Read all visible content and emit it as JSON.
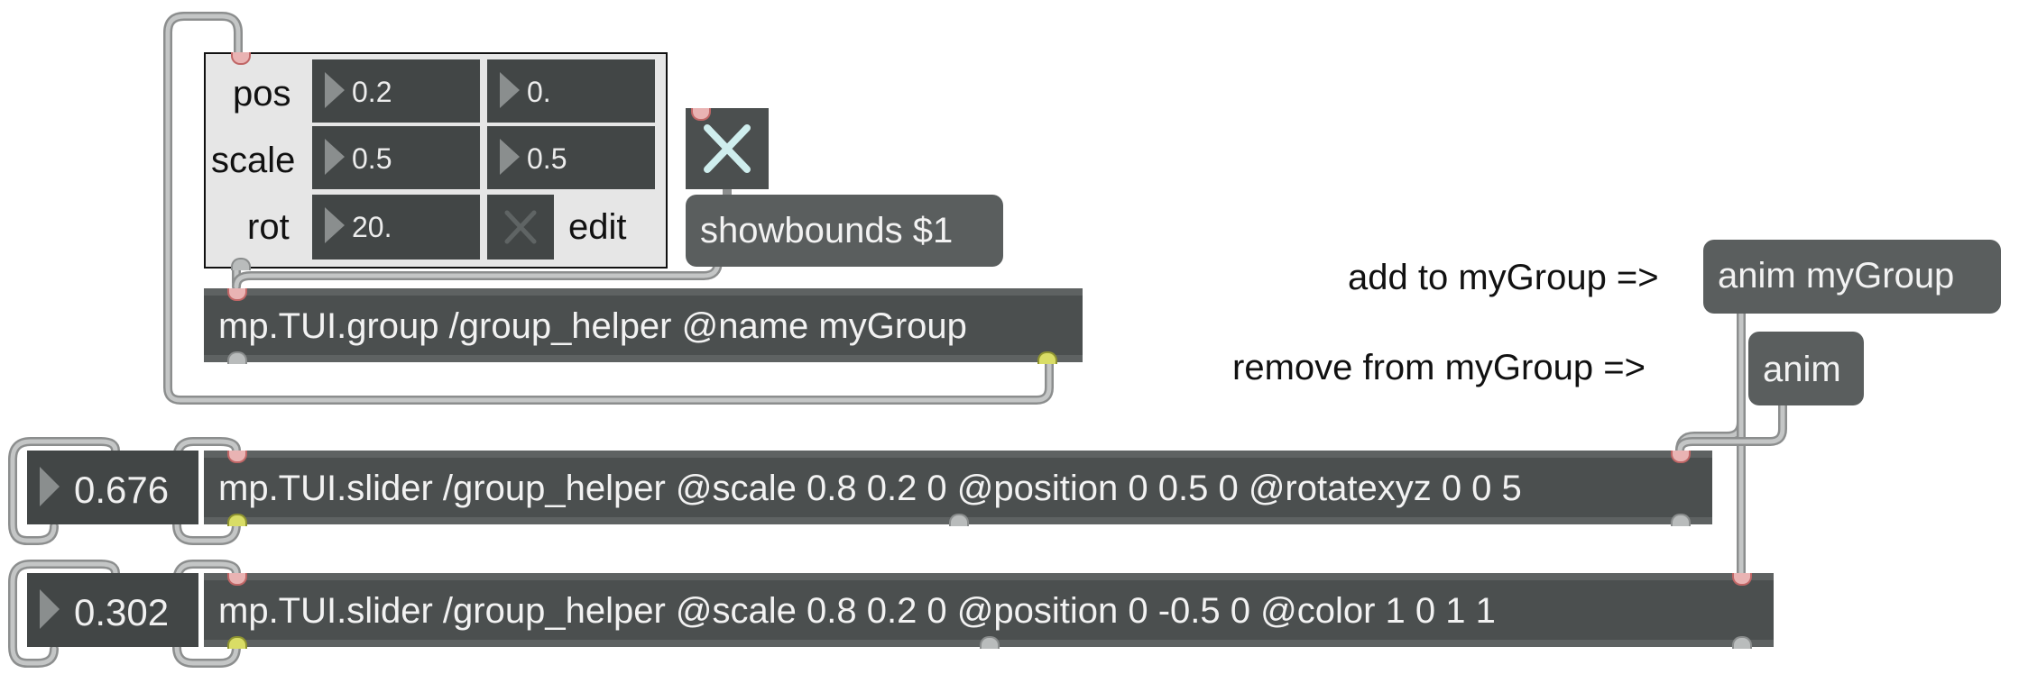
{
  "panel": {
    "pos_label": "pos",
    "scale_label": "scale",
    "rot_label": "rot",
    "edit_label": "edit",
    "pos_x": "0.2",
    "pos_y": "0.",
    "scale_x": "0.5",
    "scale_y": "0.5",
    "rot": "20."
  },
  "showbounds_msg": "showbounds $1",
  "group_obj": "mp.TUI.group /group_helper @name myGroup",
  "comments": {
    "add": "add to myGroup =>",
    "remove": "remove from myGroup =>"
  },
  "messages": {
    "anim_group": "anim myGroup",
    "anim": "anim"
  },
  "slider1": {
    "value": "0.676",
    "text": "mp.TUI.slider /group_helper @scale 0.8 0.2 0 @position 0 0.5 0 @rotatexyz 0 0 5"
  },
  "slider2": {
    "value": "0.302",
    "text": "mp.TUI.slider /group_helper @scale 0.8 0.2 0 @position 0 -0.5 0 @color 1 0 1 1"
  },
  "colors": {
    "object_bg": "#4b4f4f",
    "message_bg": "#5a5e5e",
    "cord": "#a8aaaa",
    "inlet": "#e9b3b3",
    "outlet": "#d9dd66"
  }
}
